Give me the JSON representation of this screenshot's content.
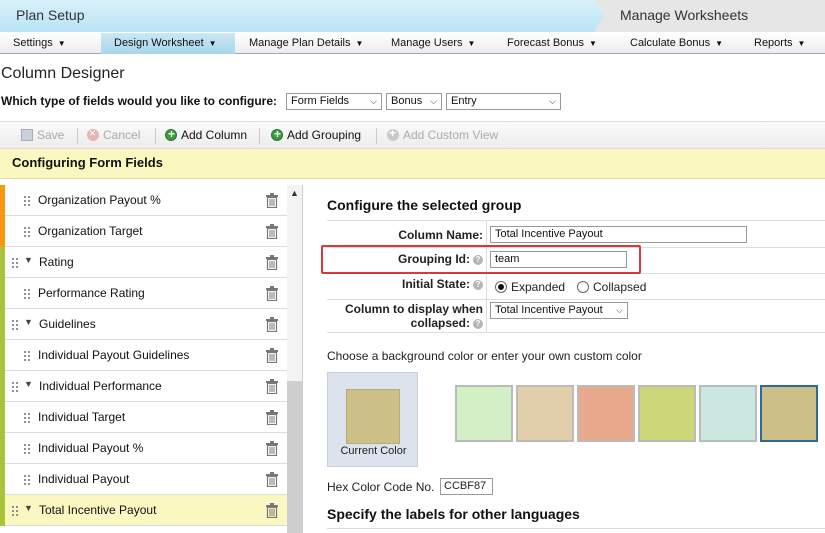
{
  "wizard": {
    "step1": "Plan Setup",
    "step2": "Manage Worksheets"
  },
  "menu": [
    {
      "label": "Settings"
    },
    {
      "label": "Design Worksheet",
      "active": true
    },
    {
      "label": "Manage Plan Details"
    },
    {
      "label": "Manage Users"
    },
    {
      "label": "Forecast Bonus"
    },
    {
      "label": "Calculate Bonus"
    },
    {
      "label": "Reports"
    }
  ],
  "page_title": "Column Designer",
  "field_type": {
    "question": "Which type of fields would you like to configure:",
    "select1": "Form Fields",
    "select2": "Bonus",
    "select3": "Entry"
  },
  "toolbar": {
    "save": "Save",
    "cancel": "Cancel",
    "add_column": "Add Column",
    "add_grouping": "Add Grouping",
    "add_custom_view": "Add Custom View"
  },
  "configuring_title": "Configuring Form Fields",
  "list": [
    {
      "label": "Organization Payout %",
      "group": false
    },
    {
      "label": "Organization Target",
      "group": false
    },
    {
      "label": "Rating",
      "group": true
    },
    {
      "label": "Performance Rating",
      "group": false
    },
    {
      "label": "Guidelines",
      "group": true
    },
    {
      "label": "Individual Payout Guidelines",
      "group": false
    },
    {
      "label": "Individual Performance",
      "group": true
    },
    {
      "label": "Individual Target",
      "group": false
    },
    {
      "label": "Individual Payout %",
      "group": false
    },
    {
      "label": "Individual Payout",
      "group": false
    },
    {
      "label": "Total Incentive Payout",
      "group": true,
      "selected": true
    }
  ],
  "config": {
    "title": "Configure the selected group",
    "column_name_label": "Column Name:",
    "column_name_value": "Total Incentive Payout",
    "grouping_id_label": "Grouping Id:",
    "grouping_id_value": "team",
    "initial_state_label": "Initial State:",
    "expanded": "Expanded",
    "collapsed": "Collapsed",
    "display_label_1": "Column to display when",
    "display_label_2": "collapsed:",
    "display_value": "Total Incentive Payout"
  },
  "colors": {
    "choose_text": "Choose a background color or enter your own custom color",
    "current_label": "Current Color",
    "current_color": "#ccbf87",
    "swatches": [
      "#d2efc6",
      "#e1cfac",
      "#e8a98c",
      "#cdd678",
      "#cbe8e0",
      "#ccbf87"
    ],
    "hex_label": "Hex Color Code No.",
    "hex_value": "CCBF87"
  },
  "specify_title": "Specify the labels for other languages",
  "accent": {
    "orange": "#f39a12",
    "green": "#a8c43a",
    "selected_row": "#fbf7c0"
  }
}
